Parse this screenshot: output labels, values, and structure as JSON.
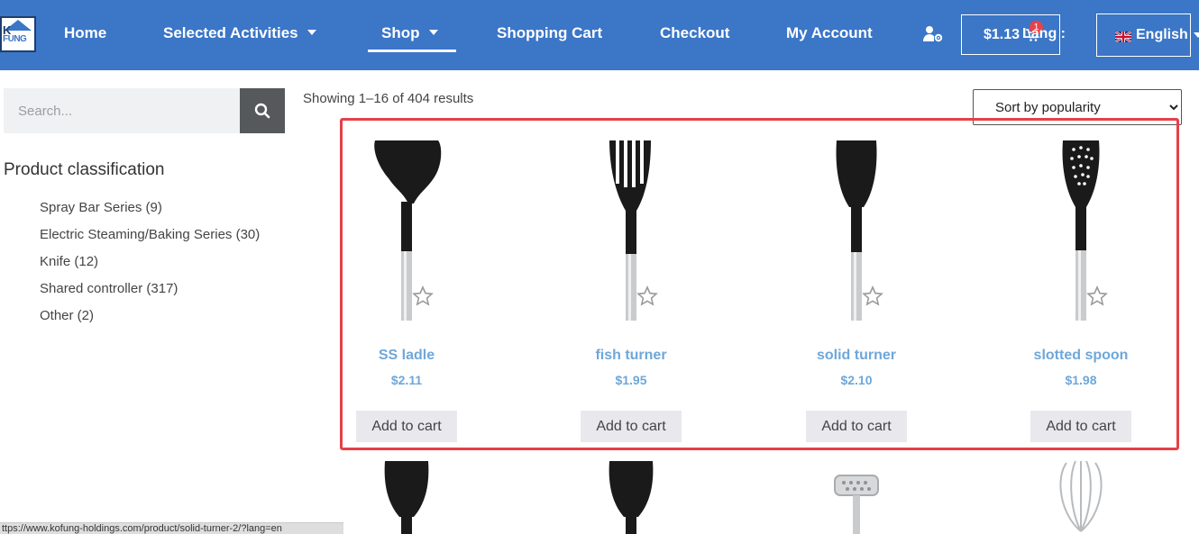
{
  "header": {
    "logo_text_top": "K",
    "logo_text_bottom": "FUNG",
    "nav": [
      {
        "label": "Home"
      },
      {
        "label": "Selected Activities"
      },
      {
        "label": "Shop"
      },
      {
        "label": "Shopping Cart"
      },
      {
        "label": "Checkout"
      },
      {
        "label": "My Account"
      }
    ],
    "active_nav": "Shop",
    "cart_amount": "$1.13",
    "cart_count": "1",
    "lang_label": "Lang :",
    "lang_selected": "English",
    "user_icon": "user-gear-icon"
  },
  "sidebar": {
    "search_placeholder": "Search...",
    "title": "Product classification",
    "categories": [
      {
        "label": "Spray Bar Series (9)"
      },
      {
        "label": "Electric Steaming/Baking Series (30)"
      },
      {
        "label": "Knife (12)"
      },
      {
        "label": "Shared controller (317)"
      },
      {
        "label": "Other (2)"
      }
    ]
  },
  "main": {
    "results_text": "Showing 1–16 of 404 results",
    "sort_selected": "Sort by popularity",
    "products": [
      {
        "name": "SS ladle",
        "price": "$2.11",
        "button": "Add to cart"
      },
      {
        "name": "fish turner",
        "price": "$1.95",
        "button": "Add to cart"
      },
      {
        "name": "solid turner",
        "price": "$2.10",
        "button": "Add to cart"
      },
      {
        "name": "slotted spoon",
        "price": "$1.98",
        "button": "Add to cart"
      }
    ]
  },
  "status_bar": "ttps://www.kofung-holdings.com/product/solid-turner-2/?lang=en",
  "colors": {
    "header_bg": "#3b76c7",
    "product_link": "#6ea7d9",
    "highlight": "#e5404a"
  }
}
